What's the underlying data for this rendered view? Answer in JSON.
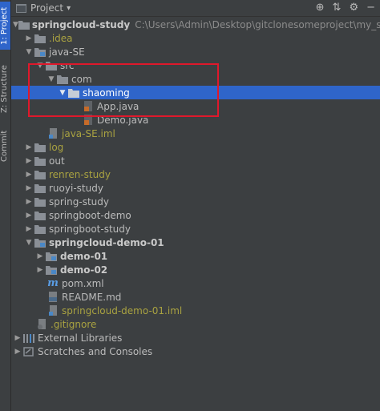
{
  "sidebar": {
    "tabs": [
      {
        "label": "1: Project",
        "active": true
      },
      {
        "label": "Z: Structure",
        "active": false
      },
      {
        "label": "Commit",
        "active": false
      }
    ]
  },
  "header": {
    "title": "Project",
    "tools": [
      "target-icon",
      "collapse-icon",
      "gear-icon",
      "minimize-icon"
    ]
  },
  "tree": {
    "root": {
      "label": "springcloud-study",
      "path": "C:\\Users\\Admin\\Desktop\\gitclonesomeproject\\my_study\\springclo"
    },
    "items": [
      {
        "label": ".idea"
      },
      {
        "label": "java-SE"
      },
      {
        "label": "src"
      },
      {
        "label": "com"
      },
      {
        "label": "shaoming"
      },
      {
        "label": "App.java"
      },
      {
        "label": "Demo.java"
      },
      {
        "label": "java-SE.iml"
      },
      {
        "label": "log"
      },
      {
        "label": "out"
      },
      {
        "label": "renren-study"
      },
      {
        "label": "ruoyi-study"
      },
      {
        "label": "spring-study"
      },
      {
        "label": "springboot-demo"
      },
      {
        "label": "springboot-study"
      },
      {
        "label": "springcloud-demo-01"
      },
      {
        "label": "demo-01"
      },
      {
        "label": "demo-02"
      },
      {
        "label": "pom.xml"
      },
      {
        "label": "README.md"
      },
      {
        "label": "springcloud-demo-01.iml"
      },
      {
        "label": ".gitignore"
      },
      {
        "label": "External Libraries"
      },
      {
        "label": "Scratches and Consoles"
      }
    ]
  },
  "colors": {
    "background": "#3c3f41",
    "selection": "#2f65ca",
    "folder": "#8a8f96",
    "olive_text": "#a9a241",
    "highlight_box": "#e0182b"
  }
}
